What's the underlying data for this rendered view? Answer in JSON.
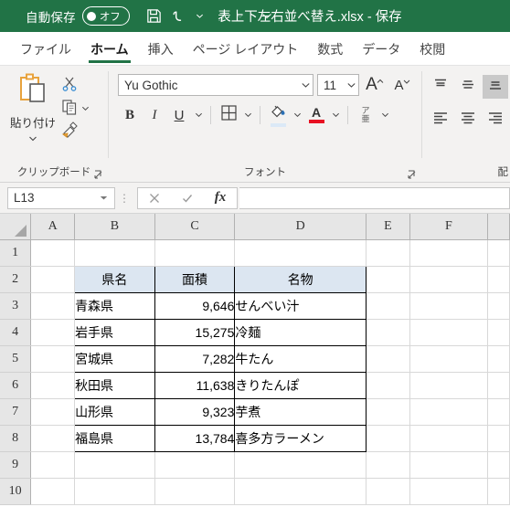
{
  "titlebar": {
    "autosave_label": "自動保存",
    "autosave_state": "オフ",
    "save_icon": "save-icon",
    "undo_icon": "undo-icon",
    "redo_icon": "redo-icon",
    "customize_icon": "chevron-down-icon",
    "document_title": "表上下左右並べ替え.xlsx - 保存",
    "accent_color": "#217346"
  },
  "tabs": [
    {
      "label": "ファイル",
      "active": false
    },
    {
      "label": "ホーム",
      "active": true
    },
    {
      "label": "挿入",
      "active": false
    },
    {
      "label": "ページ レイアウト",
      "active": false
    },
    {
      "label": "数式",
      "active": false
    },
    {
      "label": "データ",
      "active": false
    },
    {
      "label": "校閲",
      "active": false
    }
  ],
  "ribbon": {
    "clipboard": {
      "group_label": "クリップボード",
      "paste_label": "貼り付け",
      "paste_icon": "paste-icon",
      "cut_icon": "scissors-icon",
      "copy_icon": "copy-icon",
      "format_painter_icon": "format-painter-icon",
      "launcher_icon": "dialog-launcher-icon"
    },
    "font": {
      "group_label": "フォント",
      "font_name": "Yu Gothic",
      "font_size": "11",
      "grow_font": "A",
      "shrink_font": "A",
      "bold": "B",
      "italic": "I",
      "underline": "U",
      "borders_icon": "borders-icon",
      "fill_color_icon": "fill-color-icon",
      "fill_color": "#dbe9f7",
      "font_color_icon": "font-color-icon",
      "font_color": "#e81123",
      "phonetic_top": "ア",
      "phonetic_bottom": "亜",
      "launcher_icon": "dialog-launcher-icon"
    },
    "alignment": {
      "group_label": "配",
      "top_align_icon": "align-top-icon",
      "middle_align_icon": "align-middle-icon",
      "bottom_align_icon": "align-bottom-icon",
      "left_align_icon": "align-left-icon",
      "center_align_icon": "align-center-icon",
      "right_align_icon": "align-right-icon",
      "selected": "bottom-align"
    }
  },
  "formula_bar": {
    "name_box": "L13",
    "dropdown_icon": "chevron-down-icon",
    "cancel_icon": "cancel-icon",
    "enter_icon": "check-icon",
    "function_icon": "fx-icon",
    "formula_value": ""
  },
  "grid": {
    "columns": [
      "A",
      "B",
      "C",
      "D",
      "E",
      "F"
    ],
    "rows": [
      "1",
      "2",
      "3",
      "4",
      "5",
      "6",
      "7",
      "8",
      "9",
      "10"
    ],
    "table": {
      "headers": [
        "県名",
        "面積",
        "名物"
      ],
      "header_fill": "#dce6f1",
      "rows": [
        {
          "ken": "青森県",
          "menseki": "9,646",
          "meibutsu": "せんべい汁"
        },
        {
          "ken": "岩手県",
          "menseki": "15,275",
          "meibutsu": "冷麺"
        },
        {
          "ken": "宮城県",
          "menseki": "7,282",
          "meibutsu": "牛たん"
        },
        {
          "ken": "秋田県",
          "menseki": "11,638",
          "meibutsu": "きりたんぽ"
        },
        {
          "ken": "山形県",
          "menseki": "9,323",
          "meibutsu": "芋煮"
        },
        {
          "ken": "福島県",
          "menseki": "13,784",
          "meibutsu": "喜多方ラーメン"
        }
      ]
    }
  }
}
